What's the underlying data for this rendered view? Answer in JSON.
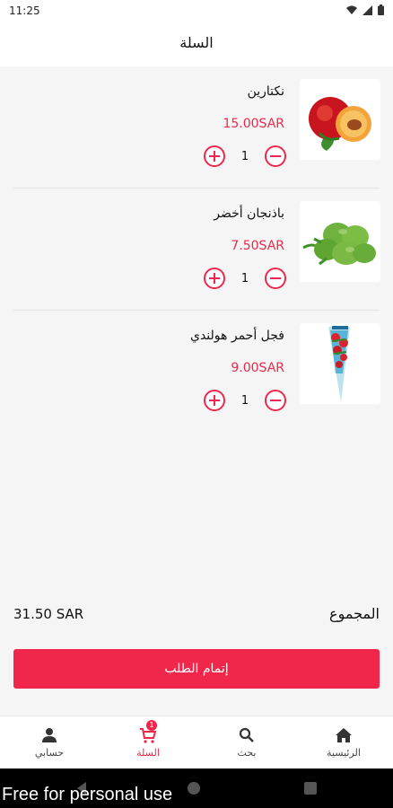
{
  "status_bar": {
    "time": "11:25",
    "icons": [
      "wifi-icon",
      "signal-icon",
      "battery-icon"
    ]
  },
  "header": {
    "title": "السلة"
  },
  "cart": {
    "items": [
      {
        "name": "نكتارين",
        "price": "15.00SAR",
        "quantity": "1",
        "image": "nectarine-image"
      },
      {
        "name": "باذنجان أخضر",
        "price": "7.50SAR",
        "quantity": "1",
        "image": "green-eggplant-image"
      },
      {
        "name": "فجل أحمر هولندي",
        "price": "9.00SAR",
        "quantity": "1",
        "image": "dutch-radish-image"
      }
    ]
  },
  "summary": {
    "total_label": "المجموع",
    "total_value": "31.50 SAR"
  },
  "checkout": {
    "label": "إتمام الطلب"
  },
  "bottom_nav": {
    "items": [
      {
        "label": "حسابي",
        "icon": "person-icon"
      },
      {
        "label": "السلة",
        "icon": "cart-icon",
        "badge": "1",
        "active": true
      },
      {
        "label": "بحث",
        "icon": "search-icon"
      },
      {
        "label": "الرئيسية",
        "icon": "home-icon"
      }
    ]
  },
  "watermark": "Free for personal use",
  "colors": {
    "accent": "#f0274a",
    "background": "#f5f5f5",
    "surface": "#ffffff"
  }
}
